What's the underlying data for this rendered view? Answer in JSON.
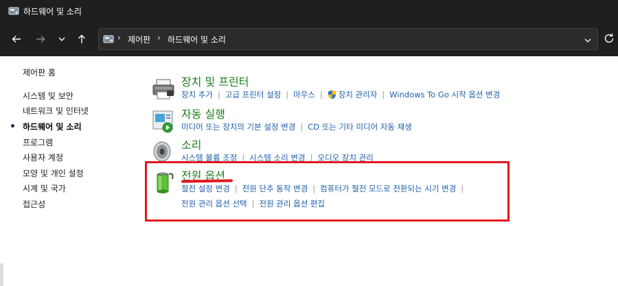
{
  "window": {
    "title": "하드웨어 및 소리"
  },
  "address": {
    "crumbs": [
      "제어판",
      "하드웨어 및 소리"
    ]
  },
  "sidebar": {
    "home": "제어판 홈",
    "items": [
      {
        "label": "시스템 및 보안",
        "active": false
      },
      {
        "label": "네트워크 및 인터넷",
        "active": false
      },
      {
        "label": "하드웨어 및 소리",
        "active": true
      },
      {
        "label": "프로그램",
        "active": false
      },
      {
        "label": "사용자 계정",
        "active": false
      },
      {
        "label": "모양 및 개인 설정",
        "active": false
      },
      {
        "label": "시계 및 국가",
        "active": false
      },
      {
        "label": "접근성",
        "active": false
      }
    ]
  },
  "categories": [
    {
      "title": "장치 및 프린터",
      "icon": "printer-icon",
      "tasks": [
        "장치 추가",
        "고급 프린터 설정",
        "마우스",
        "장치 관리자",
        "Windows To Go 시작 옵션 변경"
      ]
    },
    {
      "title": "자동 실행",
      "icon": "autoplay-icon",
      "tasks": [
        "미디어 또는 장치의 기본 설정 변경",
        "CD 또는 기타 미디어 자동 재생"
      ]
    },
    {
      "title": "소리",
      "icon": "speaker-icon",
      "tasks": [
        "시스템 볼륨 조정",
        "시스템 소리 변경",
        "오디오 장치 관리"
      ]
    },
    {
      "title": "전원 옵션",
      "icon": "battery-icon",
      "tasks": [
        "절전 설정 변경",
        "전원 단추 동작 변경",
        "컴퓨터가 절전 모드로 전환되는 시기 변경"
      ],
      "tasks2": [
        "전원 관리 옵션 선택",
        "전원 관리 옵션 편집"
      ]
    }
  ],
  "colors": {
    "highlight": "#e3171f",
    "link": "#1e5ea8",
    "heading": "#1e7e1e",
    "chrome": "#1f1f1f"
  }
}
